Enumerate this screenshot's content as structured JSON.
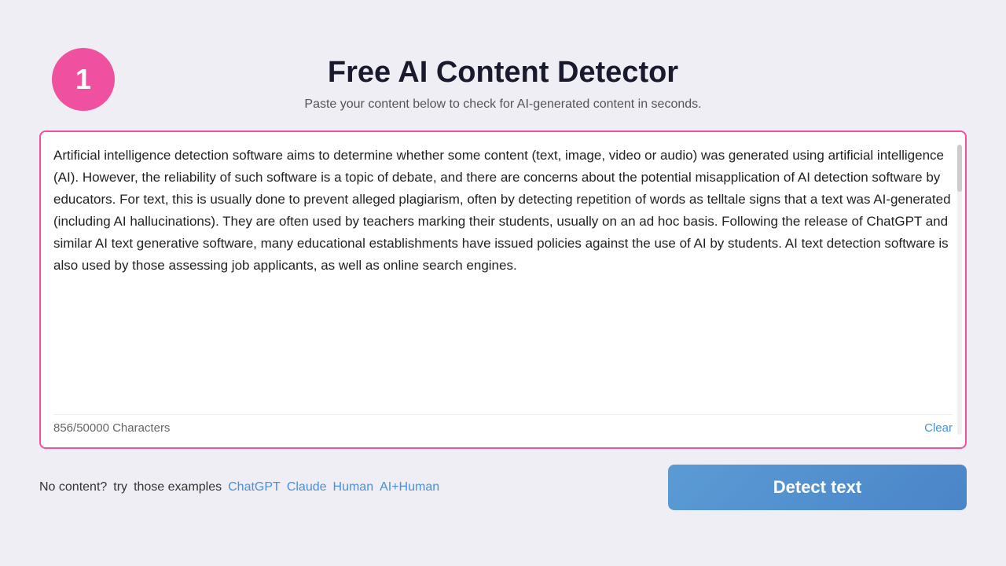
{
  "page": {
    "title": "Free AI Content Detector",
    "subtitle": "Paste your content below to check for AI-generated content in seconds.",
    "step_number": "1"
  },
  "textarea": {
    "content": "Artificial intelligence detection software aims to determine whether some content (text, image, video or audio) was generated using artificial intelligence (AI). However, the reliability of such software is a topic of debate, and there are concerns about the potential misapplication of AI detection software by educators. For text, this is usually done to prevent alleged plagiarism, often by detecting repetition of words as telltale signs that a text was AI-generated (including AI hallucinations). They are often used by teachers marking their students, usually on an ad hoc basis. Following the release of ChatGPT and similar AI text generative software, many educational establishments have issued policies against the use of AI by students. AI text detection software is also used by those assessing job applicants, as well as online search engines.",
    "char_count": "856/50000 Characters",
    "clear_label": "Clear"
  },
  "examples": {
    "no_content_text": "No content?",
    "try_text": "try",
    "those_examples_text": "those examples",
    "links": [
      {
        "label": "ChatGPT",
        "id": "chatgpt"
      },
      {
        "label": "Claude",
        "id": "claude"
      },
      {
        "label": "Human",
        "id": "human"
      },
      {
        "label": "AI+Human",
        "id": "ai-human"
      }
    ]
  },
  "detect_button": {
    "label": "Detect text"
  },
  "colors": {
    "pink": "#f050a0",
    "blue_link": "#4a90d9",
    "button_bg": "#5b9bd5"
  }
}
